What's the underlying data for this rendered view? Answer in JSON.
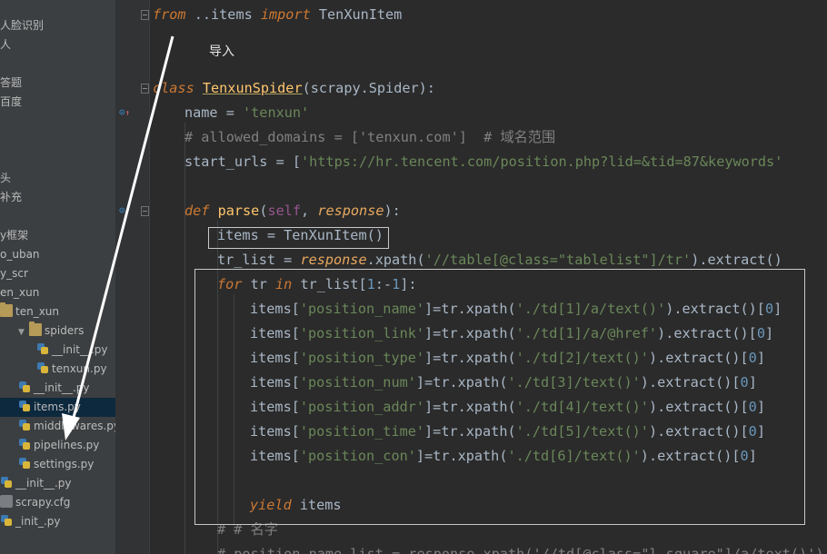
{
  "sidebar": {
    "items": [
      {
        "label": "",
        "indent": 0,
        "icon": "none"
      },
      {
        "label": "人脸识别",
        "indent": 0,
        "icon": "none"
      },
      {
        "label": "人",
        "indent": 0,
        "icon": "none"
      },
      {
        "label": "",
        "indent": 0,
        "icon": "none"
      },
      {
        "label": "答题",
        "indent": 0,
        "icon": "none"
      },
      {
        "label": "百度",
        "indent": 0,
        "icon": "none"
      },
      {
        "label": "",
        "indent": 0,
        "icon": "none"
      },
      {
        "label": "",
        "indent": 0,
        "icon": "none"
      },
      {
        "label": "",
        "indent": 0,
        "icon": "none"
      },
      {
        "label": "头",
        "indent": 0,
        "icon": "none"
      },
      {
        "label": "补充",
        "indent": 0,
        "icon": "none"
      },
      {
        "label": "",
        "indent": 0,
        "icon": "none"
      },
      {
        "label": "y框架",
        "indent": 0,
        "icon": "none"
      },
      {
        "label": "o_uban",
        "indent": 0,
        "icon": "none"
      },
      {
        "label": "y_scr",
        "indent": 0,
        "icon": "none"
      },
      {
        "label": "en_xun",
        "indent": 0,
        "icon": "none"
      },
      {
        "label": "ten_xun",
        "indent": 0,
        "icon": "folder"
      },
      {
        "label": "spiders",
        "indent": 1,
        "icon": "folder"
      },
      {
        "label": "__init__.py",
        "indent": 2,
        "icon": "py"
      },
      {
        "label": "tenxun.py",
        "indent": 2,
        "icon": "py"
      },
      {
        "label": "__init__.py",
        "indent": 1,
        "icon": "py"
      },
      {
        "label": "items.py",
        "indent": 1,
        "icon": "py"
      },
      {
        "label": "middlewares.py",
        "indent": 1,
        "icon": "py"
      },
      {
        "label": "pipelines.py",
        "indent": 1,
        "icon": "py"
      },
      {
        "label": "settings.py",
        "indent": 1,
        "icon": "py"
      },
      {
        "label": "__init__.py",
        "indent": 0,
        "icon": "py"
      },
      {
        "label": "scrapy.cfg",
        "indent": 0,
        "icon": "cfg"
      },
      {
        "label": "_init_.py",
        "indent": 0,
        "icon": "py"
      }
    ],
    "selected_label": "items.py"
  },
  "code": {
    "l1_from": "from",
    "l1_mod": " ..items ",
    "l1_import": "import",
    "l1_name": " TenXunItem",
    "annotation": "导入",
    "l3_class": "class",
    "l3_name": "TenxunSpider",
    "l3_base": "(scrapy.Spider):",
    "l4_name": "name = ",
    "l4_val": "'tenxun'",
    "l5_comment": "# allowed_domains = ['tenxun.com']  # 域名范围",
    "l6_start": "start_urls = [",
    "l6_val": "'https://hr.tencent.com/position.php?lid=&tid=87&keywords'",
    "l8_def": "def",
    "l8_name": "parse",
    "l8_open": "(",
    "l8_self": "self",
    "l8_comma": ", ",
    "l8_param": "response",
    "l8_close": "):",
    "l9": "items = TenXunItem()",
    "l10_a": "tr_list = ",
    "l10_resp": "response",
    "l10_b": ".xpath(",
    "l10_str": "'//table[@class=\"tablelist\"]/tr'",
    "l10_c": ").extract()",
    "l11_for": "for",
    "l11_a": " tr ",
    "l11_in": "in",
    "l11_b": " tr_list[",
    "l11_n1": "1",
    "l11_c": ":-",
    "l11_n2": "1",
    "l11_d": "]:",
    "field_rows": [
      {
        "key": "'position_name'",
        "path": "'./td[1]/a/text()'"
      },
      {
        "key": "'position_link'",
        "path": "'./td[1]/a/@href'"
      },
      {
        "key": "'position_type'",
        "path": "'./td[2]/text()'"
      },
      {
        "key": "'position_num'",
        "path": "'./td[3]/text()'"
      },
      {
        "key": "'position_addr'",
        "path": "'./td[4]/text()'"
      },
      {
        "key": "'position_time'",
        "path": "'./td[5]/text()'"
      },
      {
        "key": "'position_con'",
        "path": "'./td[6]/text()'"
      }
    ],
    "row_items": "items[",
    "row_mid": "]=tr.xpath(",
    "row_end": ").extract()[",
    "row_zero": "0",
    "row_close": "]",
    "yield_kw": "yield",
    "yield_rest": " items",
    "c1": "# # 名字",
    "c2": "# position_name_list = response.xpath('//td[@class=\"l square\"]/a/text()')"
  },
  "colors": {
    "editor_bg": "#2b2b2b",
    "sidebar_bg": "#3c3f41",
    "keyword": "#cc7832",
    "string": "#6a8759",
    "comment": "#808080",
    "function": "#ffc66d",
    "number": "#6897bb"
  }
}
